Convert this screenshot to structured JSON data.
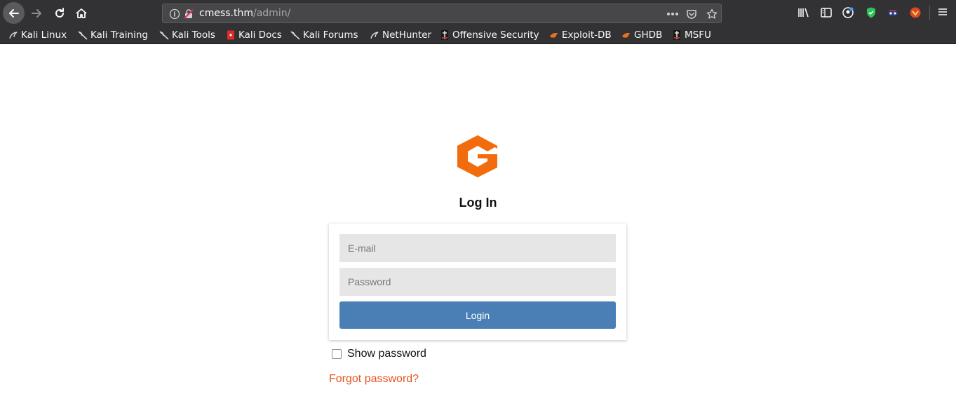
{
  "browser": {
    "url_host": "cmess.thm",
    "url_path": "/admin/"
  },
  "bookmarks": [
    {
      "label": "Kali Linux",
      "icon": "kali-dragon-icon"
    },
    {
      "label": "Kali Training",
      "icon": "kali-dragon-icon"
    },
    {
      "label": "Kali Tools",
      "icon": "kali-dragon-icon"
    },
    {
      "label": "Kali Docs",
      "icon": "kali-docs-icon"
    },
    {
      "label": "Kali Forums",
      "icon": "kali-dragon-icon"
    },
    {
      "label": "NetHunter",
      "icon": "kali-dragon-icon"
    },
    {
      "label": "Offensive Security",
      "icon": "offsec-icon"
    },
    {
      "label": "Exploit-DB",
      "icon": "exploitdb-icon"
    },
    {
      "label": "GHDB",
      "icon": "exploitdb-icon"
    },
    {
      "label": "MSFU",
      "icon": "offsec-icon"
    }
  ],
  "login": {
    "title": "Log In",
    "email_placeholder": "E-mail",
    "password_placeholder": "Password",
    "button_label": "Login",
    "show_password_label": "Show password",
    "forgot_password_label": "Forgot password?"
  },
  "colors": {
    "accent_orange": "#f26c0d",
    "login_button": "#4a7fb5",
    "link": "#e8541d"
  }
}
